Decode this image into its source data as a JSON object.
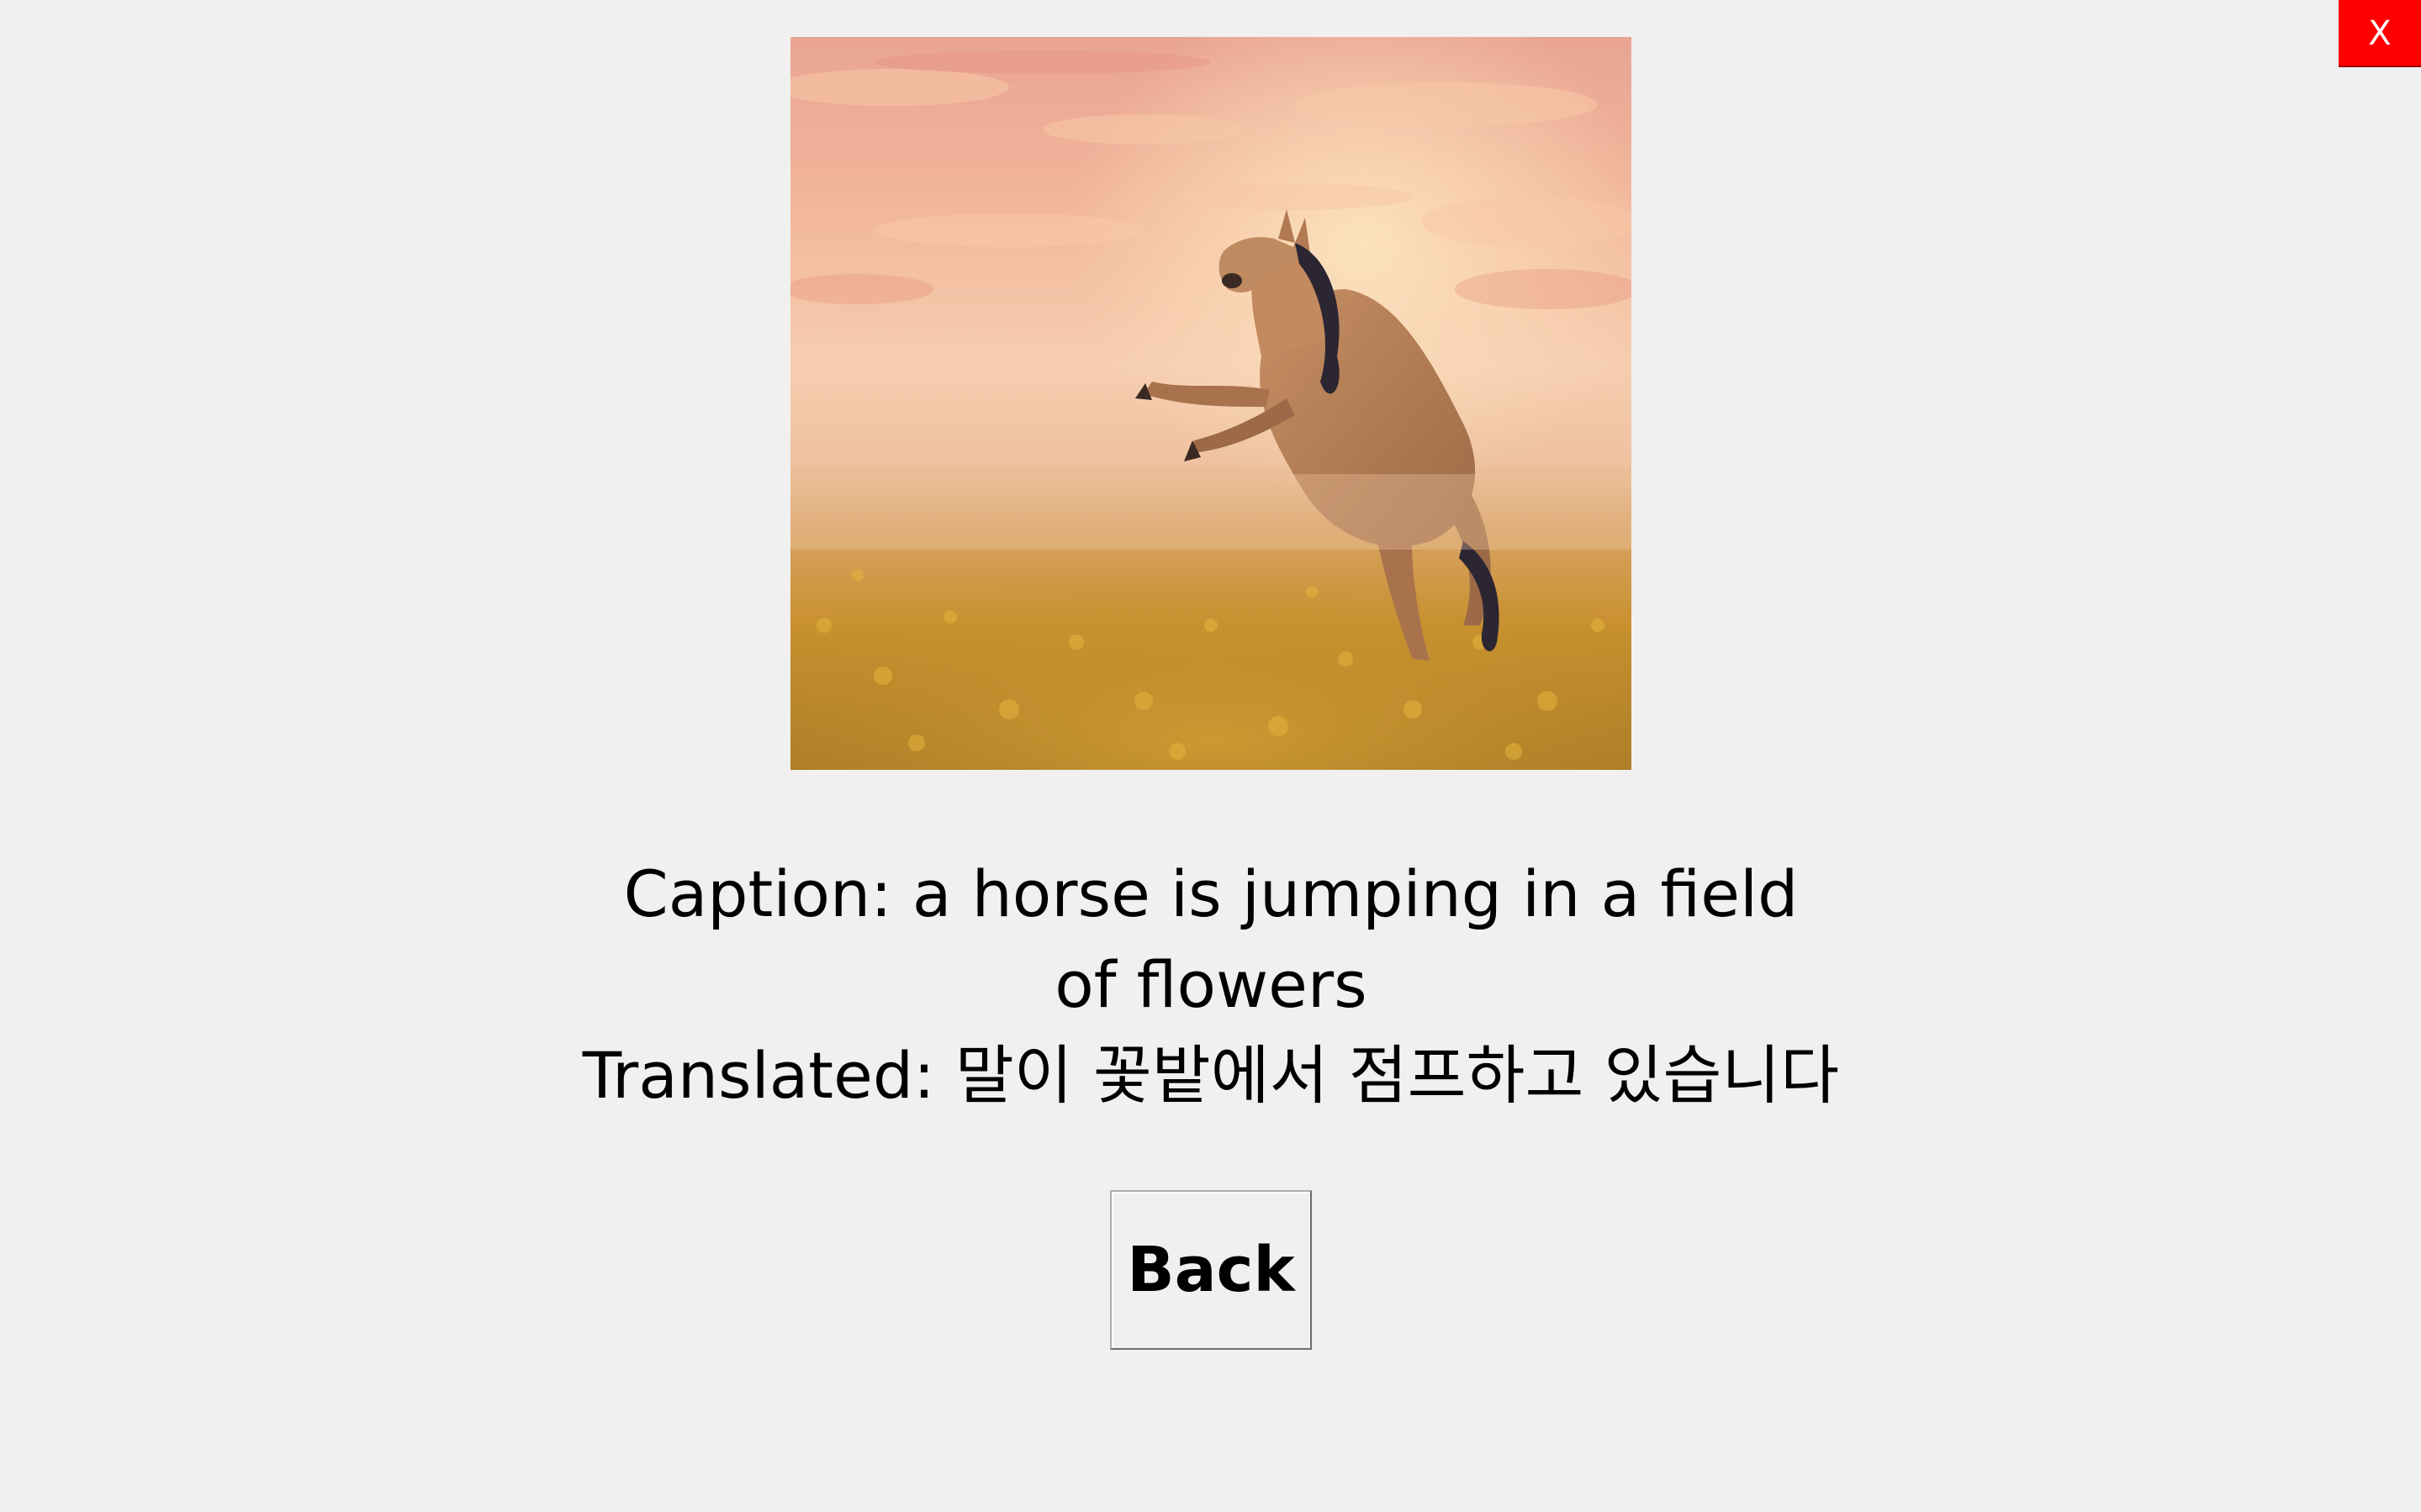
{
  "window": {
    "close_label": "X"
  },
  "image": {
    "subject": "horse-rearing-in-flower-field"
  },
  "caption": {
    "caption_text": "Caption: a horse is jumping in a field of flowers",
    "translated_text": "Translated: 말이 꽃밭에서 점프하고 있습니다"
  },
  "actions": {
    "back_label": "Back"
  },
  "colors": {
    "background": "#f0f0f0",
    "close_button": "#ff0000"
  }
}
